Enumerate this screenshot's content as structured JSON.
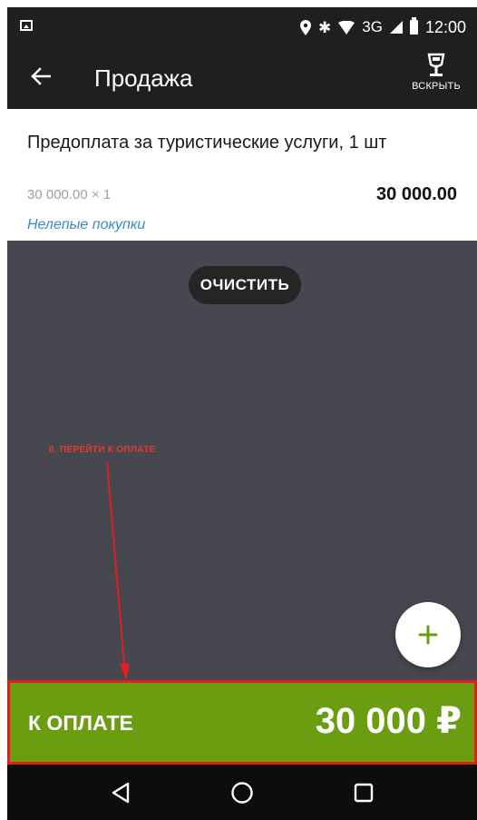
{
  "status_bar": {
    "network": "3G",
    "time": "12:00",
    "icons": [
      "gallery-icon",
      "location-icon",
      "bluetooth-icon",
      "wifi-icon",
      "signal-icon",
      "battery-icon"
    ]
  },
  "app_bar": {
    "title": "Продажа",
    "open_drawer_label": "ВСКРЫТЬ"
  },
  "item": {
    "name": "Предоплата за туристические услуги, 1 шт",
    "qty_price": "30 000.00 × 1",
    "total": "30 000.00",
    "category": "Нелепые покупки"
  },
  "content": {
    "clear_label": "ОЧИСТИТЬ",
    "annotation": "6. ПЕРЕЙТИ К ОПЛАТЕ"
  },
  "pay_bar": {
    "label": "К ОПЛАТЕ",
    "amount": "30 000 ₽"
  },
  "colors": {
    "accent_green": "#6a9d10",
    "highlight_red": "#e02020",
    "link_blue": "#3a87d4",
    "content_bg": "#47474f"
  }
}
